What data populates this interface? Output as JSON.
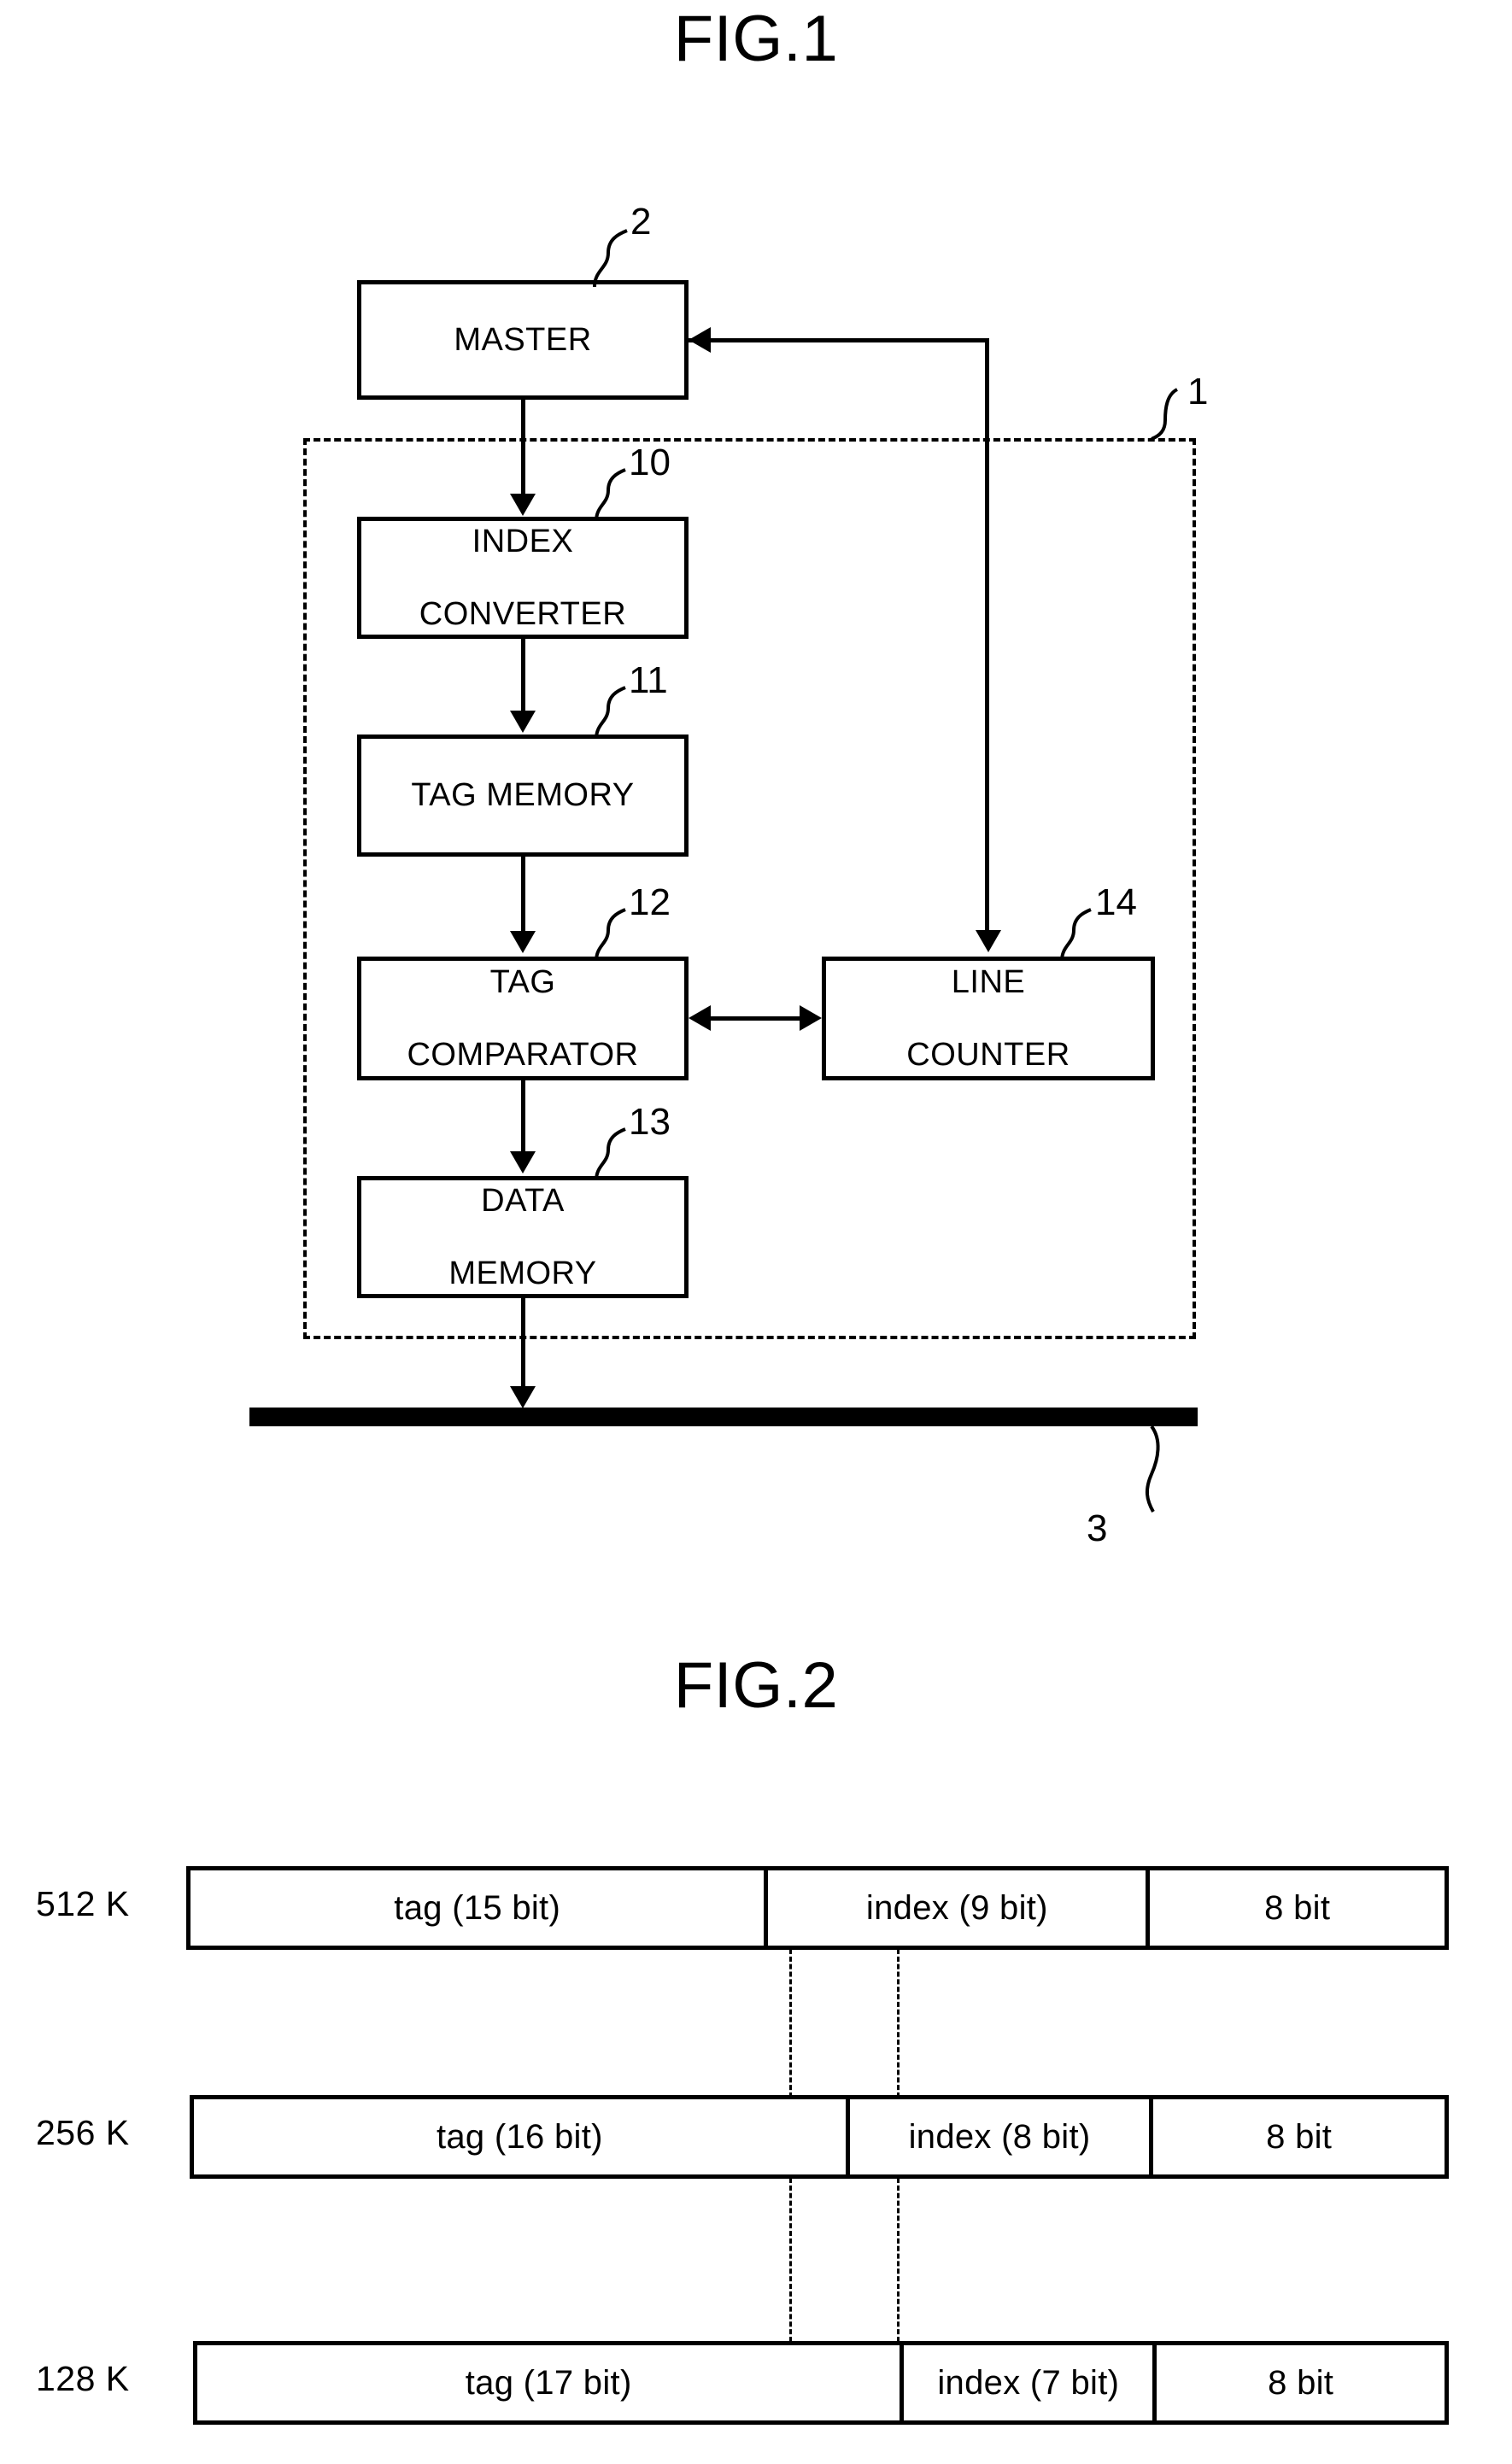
{
  "figures": {
    "fig1": {
      "title": "FIG.1",
      "blocks": [
        {
          "id": "master",
          "label": "MASTER",
          "ref": "2"
        },
        {
          "id": "index-converter",
          "label": "INDEX\nCONVERTER",
          "ref": "10"
        },
        {
          "id": "tag-memory",
          "label": "TAG MEMORY",
          "ref": "11"
        },
        {
          "id": "tag-comparator",
          "label": "TAG\nCOMPARATOR",
          "ref": "12"
        },
        {
          "id": "line-counter",
          "label": "LINE\nCOUNTER",
          "ref": "14"
        },
        {
          "id": "data-memory",
          "label": "DATA\nMEMORY",
          "ref": "13"
        }
      ],
      "block_labels": {
        "master": "MASTER",
        "index_converter_line1": "INDEX",
        "index_converter_line2": "CONVERTER",
        "tag_memory": "TAG MEMORY",
        "tag_comparator_line1": "TAG",
        "tag_comparator_line2": "COMPARATOR",
        "line_counter_line1": "LINE",
        "line_counter_line2": "COUNTER",
        "data_memory_line1": "DATA",
        "data_memory_line2": "MEMORY"
      },
      "refs": {
        "master": "2",
        "cache_enclosure": "1",
        "index_converter": "10",
        "tag_memory": "11",
        "tag_comparator": "12",
        "data_memory": "13",
        "line_counter": "14",
        "bus": "3"
      }
    },
    "fig2": {
      "title": "FIG.2",
      "rows": [
        {
          "label": "512 K",
          "fields": [
            {
              "name": "tag",
              "text": "tag (15 bit)"
            },
            {
              "name": "index",
              "text": "index (9 bit)"
            },
            {
              "name": "offset",
              "text": "8 bit"
            }
          ]
        },
        {
          "label": "256 K",
          "fields": [
            {
              "name": "tag",
              "text": "tag (16 bit)"
            },
            {
              "name": "index",
              "text": "index (8 bit)"
            },
            {
              "name": "offset",
              "text": "8 bit"
            }
          ]
        },
        {
          "label": "128 K",
          "fields": [
            {
              "name": "tag",
              "text": "tag (17 bit)"
            },
            {
              "name": "index",
              "text": "index (7 bit)"
            },
            {
              "name": "offset",
              "text": "8 bit"
            }
          ]
        }
      ]
    }
  },
  "colors": {
    "ink": "#000000",
    "paper": "#ffffff"
  }
}
